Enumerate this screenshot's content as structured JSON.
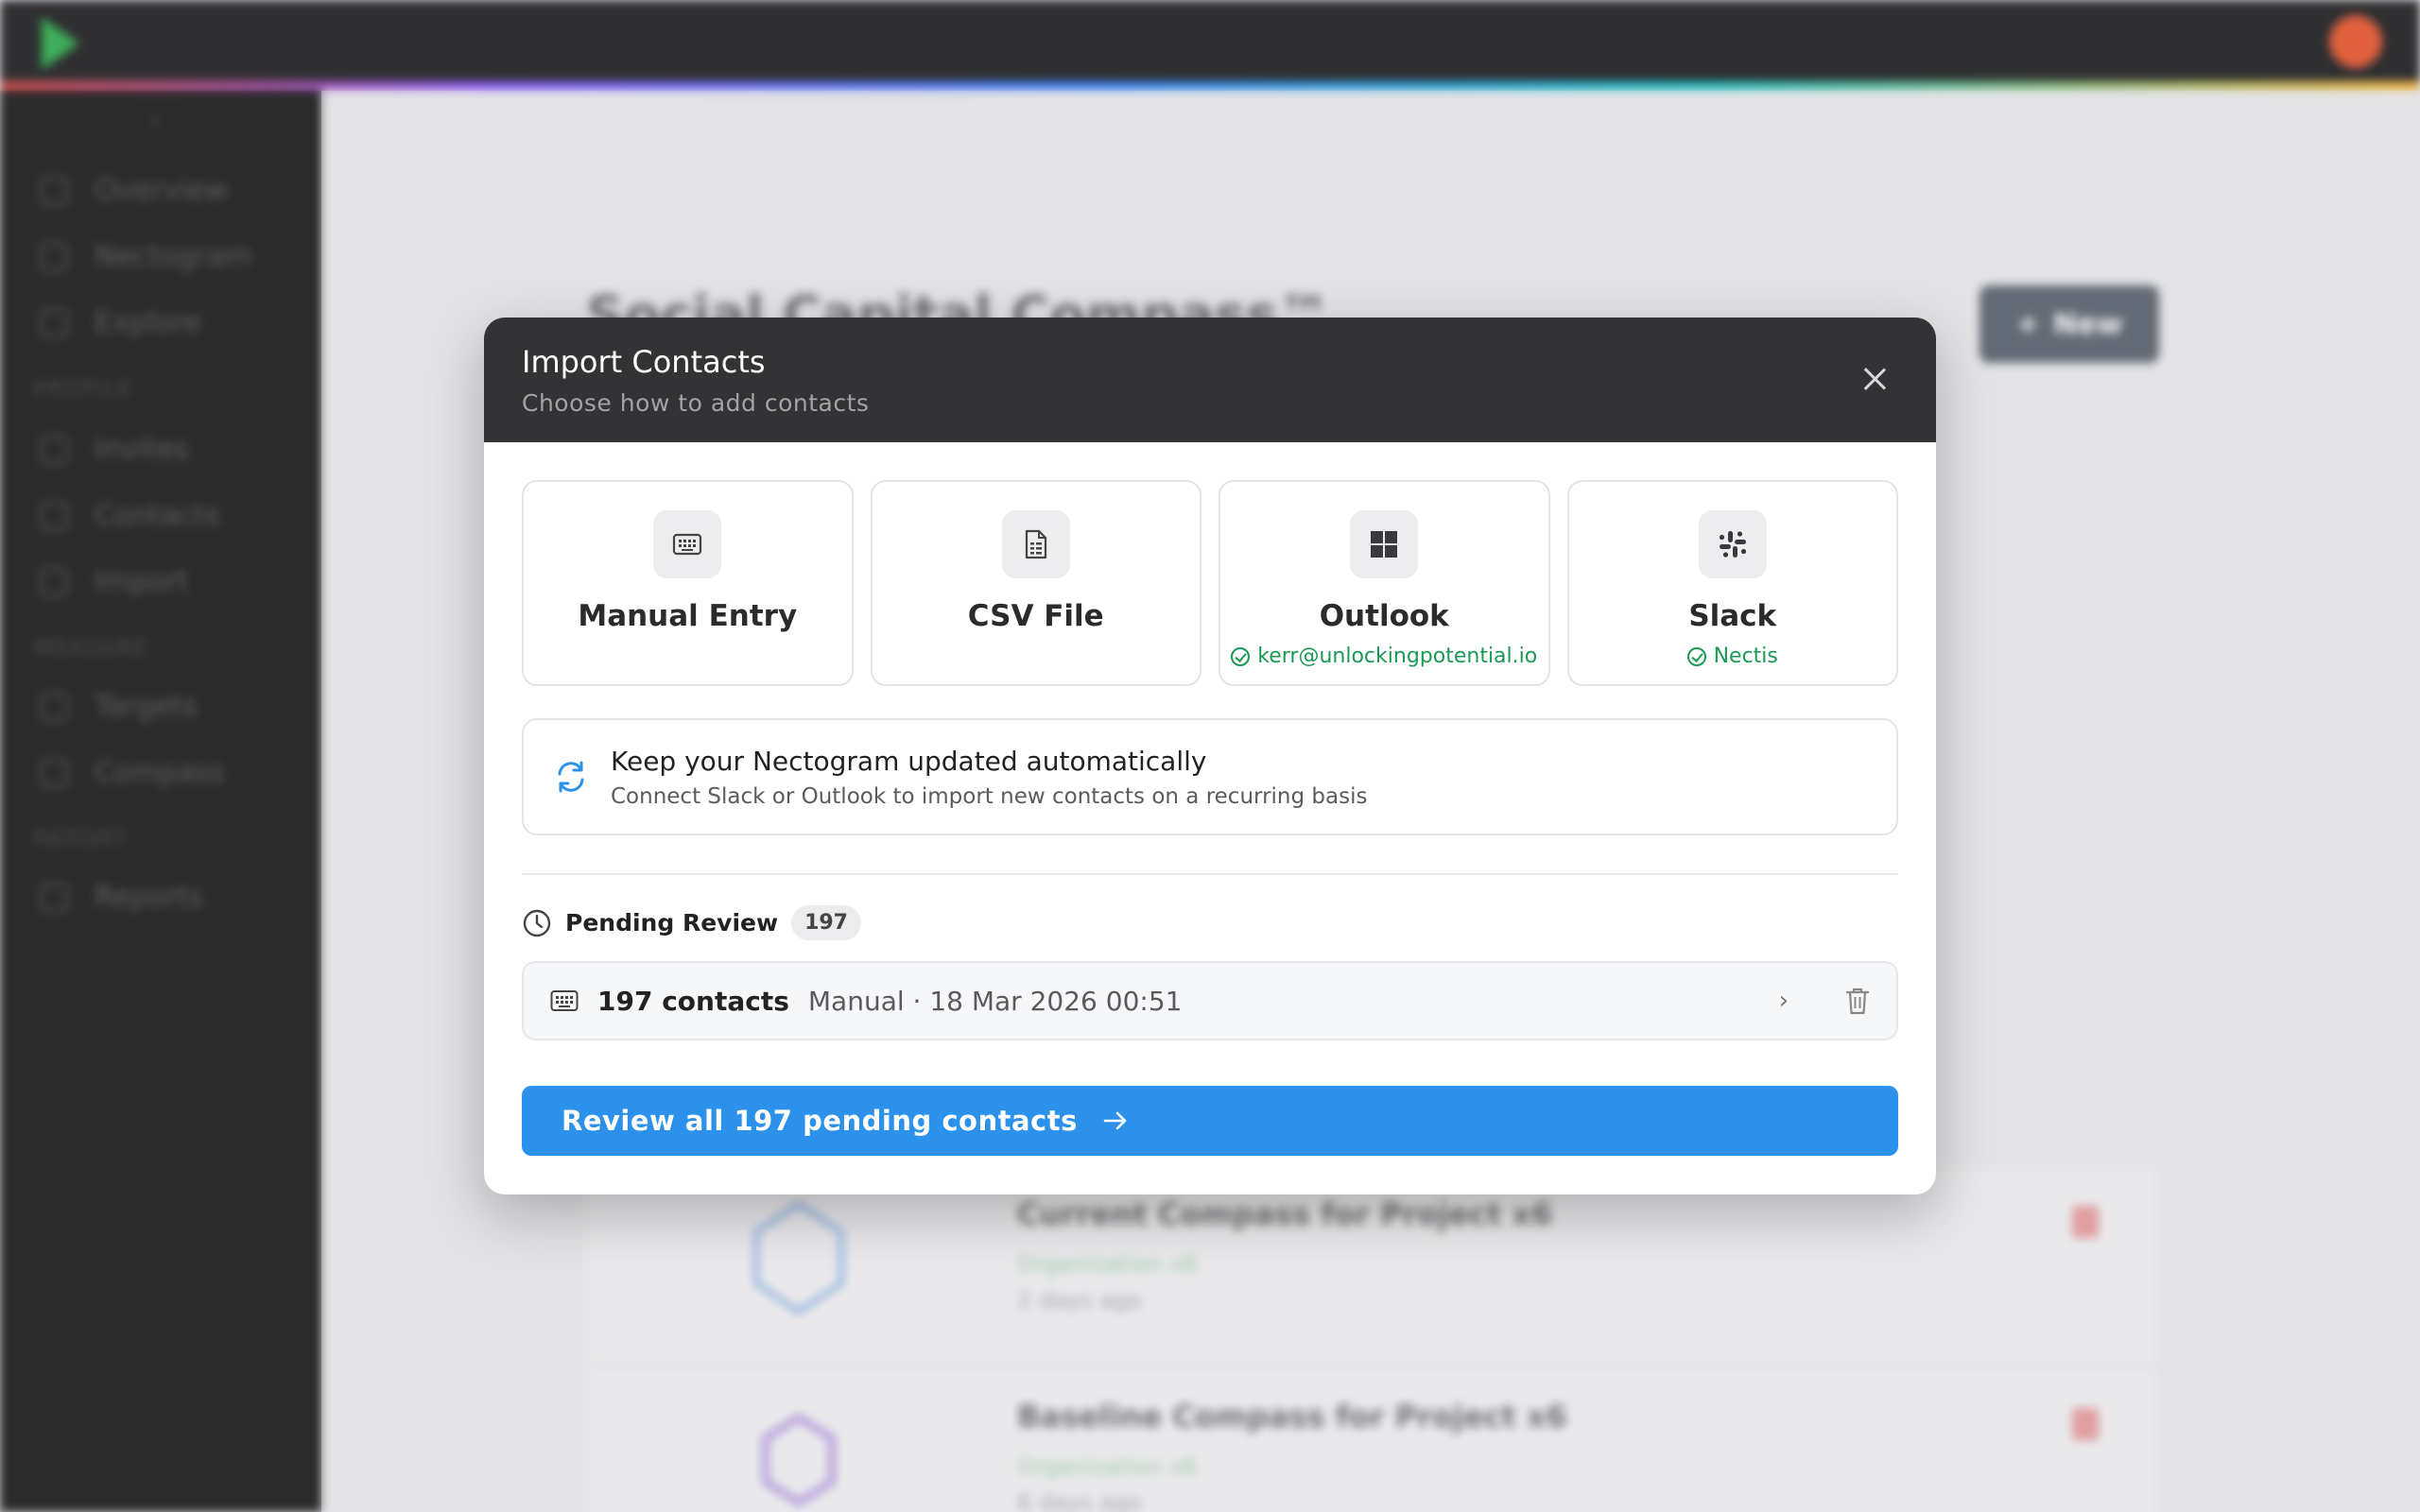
{
  "background": {
    "sidebar": {
      "items": [
        {
          "label": "Overview",
          "icon": "grid-icon"
        },
        {
          "label": "Nectogram",
          "icon": "network-icon"
        },
        {
          "label": "Explore",
          "icon": "search-icon"
        },
        {
          "label": "Invites",
          "icon": "send-icon"
        },
        {
          "label": "Contacts",
          "icon": "users-icon"
        },
        {
          "label": "Import",
          "icon": "import-icon"
        },
        {
          "label": "Targets",
          "icon": "target-icon"
        },
        {
          "label": "Compass",
          "icon": "compass-icon"
        },
        {
          "label": "Reports",
          "icon": "report-icon"
        }
      ],
      "sections": [
        "PROFILE",
        "MEASURE",
        "REPORT"
      ]
    },
    "page_title": "Social Capital Compass™",
    "new_button": "New",
    "cards": [
      {
        "title": "Current Compass for Project x6",
        "subtitle": "Organisation x6",
        "time": "2 days ago"
      },
      {
        "title": "Baseline Compass for Project x6",
        "subtitle": "Organisation x6",
        "time": "6 days ago"
      }
    ]
  },
  "modal": {
    "title": "Import Contacts",
    "subtitle": "Choose how to add contacts",
    "sources": [
      {
        "label": "Manual Entry",
        "icon": "keyboard-icon",
        "status": ""
      },
      {
        "label": "CSV File",
        "icon": "file-icon",
        "status": ""
      },
      {
        "label": "Outlook",
        "icon": "windows-icon",
        "status": "kerr@unlockingpotential.io"
      },
      {
        "label": "Slack",
        "icon": "slack-icon",
        "status": "Nectis"
      }
    ],
    "auto_sync": {
      "title": "Keep your Nectogram updated automatically",
      "subtitle": "Connect Slack or Outlook to import new contacts on a recurring basis"
    },
    "pending": {
      "title": "Pending Review",
      "count": "197",
      "batch": {
        "count_label": "197 contacts",
        "meta": "Manual · 18 Mar 2026 00:51"
      }
    },
    "review_button": "Review all 197 pending contacts",
    "colors": {
      "header_bg": "#333234",
      "accent": "#2b91ea",
      "success": "#1a9a55"
    }
  }
}
